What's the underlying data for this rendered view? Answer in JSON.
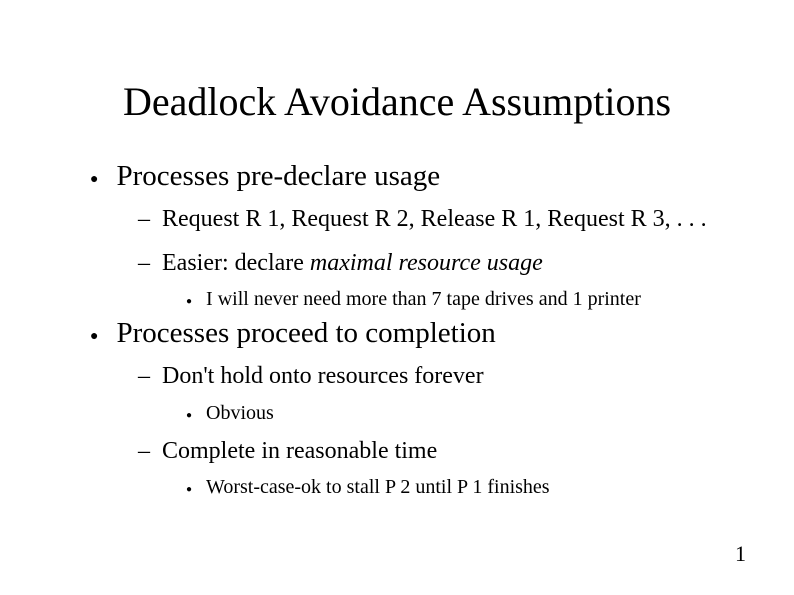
{
  "title": "Deadlock Avoidance Assumptions",
  "b1": {
    "text": "Processes pre-declare usage",
    "sub1": "Request R 1, Request R 2, Release R 1, Request R 3, . . .",
    "sub2_prefix": "Easier: declare ",
    "sub2_italic": "maximal resource usage",
    "sub2_sub": "I will never need more than 7 tape drives and 1 printer"
  },
  "b2": {
    "text": "Processes proceed to completion",
    "sub1": "Don't hold onto resources forever",
    "sub1_sub": "Obvious",
    "sub2": "Complete in reasonable time",
    "sub2_sub": "Worst-case-ok to stall P 2 until P 1 finishes"
  },
  "page": "1"
}
